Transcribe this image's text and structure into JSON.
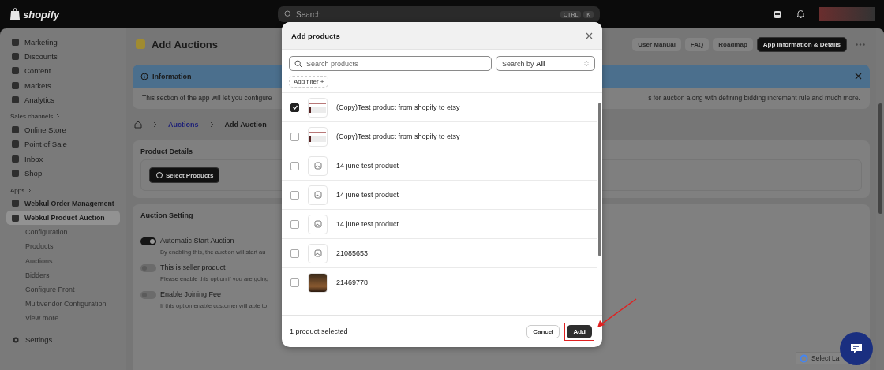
{
  "topbar": {
    "logo": "shopify",
    "search": {
      "placeholder": "Search",
      "keys": [
        "CTRL",
        "K"
      ]
    }
  },
  "sidebar": {
    "items": [
      {
        "label": "Marketing"
      },
      {
        "label": "Discounts"
      },
      {
        "label": "Content"
      },
      {
        "label": "Markets"
      },
      {
        "label": "Analytics"
      }
    ],
    "sales_channels": {
      "label": "Sales channels",
      "items": [
        {
          "label": "Online Store"
        },
        {
          "label": "Point of Sale"
        },
        {
          "label": "Inbox"
        },
        {
          "label": "Shop"
        }
      ]
    },
    "apps": {
      "label": "Apps",
      "items": [
        {
          "label": "Webkul Order Management",
          "selected": false
        },
        {
          "label": "Webkul Product Auction",
          "selected": true,
          "children": [
            "Configuration",
            "Products",
            "Auctions",
            "Bidders",
            "Configure Front",
            "Multivendor Configuration",
            "View more"
          ]
        }
      ]
    },
    "settings": "Settings"
  },
  "page": {
    "title": "Add Auctions",
    "buttons": [
      {
        "label": "User Manual",
        "kind": "secondary"
      },
      {
        "label": "FAQ",
        "kind": "secondary"
      },
      {
        "label": "Roadmap",
        "kind": "secondary"
      },
      {
        "label": "App Information & Details",
        "kind": "primary"
      }
    ],
    "info": {
      "title": "Information",
      "text_left": "This section of the app will let you configure",
      "text_right": "s for auction along with defining bidding increment rule and much more."
    },
    "breadcrumb": [
      {
        "label": "Auctions",
        "kind": "link"
      },
      {
        "label": "Add Auction",
        "kind": "current"
      }
    ],
    "product_details": {
      "title": "Product Details",
      "button": "Select Products"
    },
    "auction_setting": {
      "title": "Auction Setting",
      "toggles": [
        {
          "label": "Automatic Start Auction",
          "description": "By enabling this, the auction will start au",
          "on": true
        },
        {
          "label": "This is seller product",
          "description": "Please enable this option if you are going",
          "on": false
        },
        {
          "label": "Enable Joining Fee",
          "description": "If this option enable customer will able to",
          "on": false
        }
      ]
    }
  },
  "modal": {
    "title": "Add products",
    "search_placeholder": "Search products",
    "search_by": {
      "label": "Search by",
      "value": "All"
    },
    "add_filter": "Add filter +",
    "rows": [
      {
        "name": "(Copy)Test product from shopify to etsy",
        "selected": true,
        "kind": "image"
      },
      {
        "name": "(Copy)Test product from shopify to etsy",
        "selected": false,
        "kind": "image"
      },
      {
        "name": "14 june test product",
        "selected": false,
        "kind": "placeholder"
      },
      {
        "name": "14 june test product",
        "selected": false,
        "kind": "placeholder"
      },
      {
        "name": "14 june test product",
        "selected": false,
        "kind": "placeholder"
      },
      {
        "name": "21085653",
        "selected": false,
        "kind": "placeholder"
      },
      {
        "name": "21469778",
        "selected": false,
        "kind": "photo"
      }
    ],
    "footer_text": "1 product selected",
    "cancel": "Cancel",
    "add": "Add"
  },
  "language": "Select La"
}
